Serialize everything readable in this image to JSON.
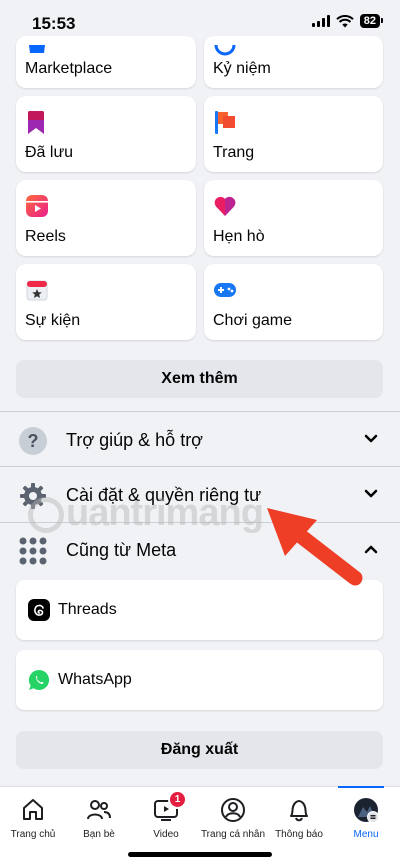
{
  "status_bar": {
    "time": "15:53",
    "battery": "82"
  },
  "shortcuts": [
    {
      "label": "Marketplace",
      "icon": "marketplace-icon"
    },
    {
      "label": "Kỷ niệm",
      "icon": "memories-icon"
    },
    {
      "label": "Đã lưu",
      "icon": "saved-bookmark-icon"
    },
    {
      "label": "Trang",
      "icon": "pages-flag-icon"
    },
    {
      "label": "Reels",
      "icon": "reels-icon"
    },
    {
      "label": "Hẹn hò",
      "icon": "dating-heart-icon"
    },
    {
      "label": "Sự kiện",
      "icon": "events-calendar-icon"
    },
    {
      "label": "Chơi game",
      "icon": "gaming-controller-icon"
    }
  ],
  "see_more_label": "Xem thêm",
  "sections": {
    "help": {
      "label": "Trợ giúp & hỗ trợ",
      "icon": "question-icon"
    },
    "settings": {
      "label": "Cài đặt & quyền riêng tư",
      "icon": "gear-icon"
    },
    "meta": {
      "label": "Cũng từ Meta",
      "icon": "meta-grid-icon"
    }
  },
  "meta_apps": [
    {
      "label": "Threads",
      "icon": "threads-icon"
    },
    {
      "label": "WhatsApp",
      "icon": "whatsapp-icon"
    }
  ],
  "logout_label": "Đăng xuất",
  "watermark": "uantrimang",
  "tabs": [
    {
      "label": "Trang chủ",
      "icon": "home-icon"
    },
    {
      "label": "Bạn bè",
      "icon": "friends-icon"
    },
    {
      "label": "Video",
      "icon": "video-icon",
      "badge": "1"
    },
    {
      "label": "Trang cá nhân",
      "icon": "profile-icon"
    },
    {
      "label": "Thông báo",
      "icon": "bell-icon"
    },
    {
      "label": "Menu",
      "icon": "avatar-menu-icon",
      "active": true
    }
  ],
  "colors": {
    "accent": "#0866ff",
    "badge": "#e41e3f",
    "arrow": "#ee3e26",
    "background": "#f0f2f5"
  }
}
